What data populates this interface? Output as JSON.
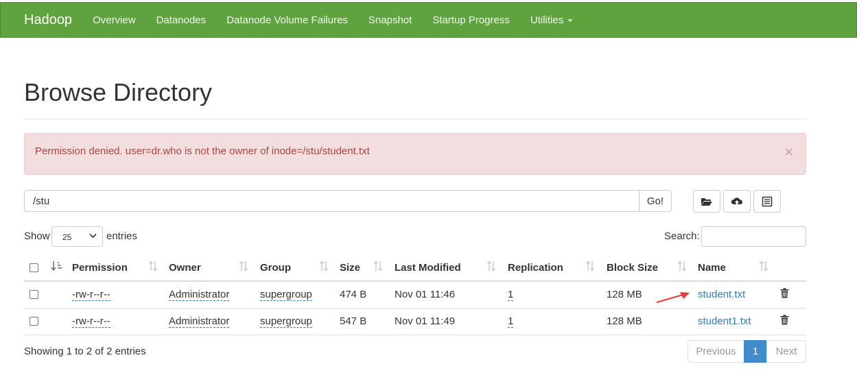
{
  "navbar": {
    "brand": "Hadoop",
    "items": [
      "Overview",
      "Datanodes",
      "Datanode Volume Failures",
      "Snapshot",
      "Startup Progress",
      "Utilities"
    ]
  },
  "page": {
    "title": "Browse Directory"
  },
  "alert": {
    "message": "Permission denied. user=dr.who is not the owner of inode=/stu/student.txt",
    "close": "×"
  },
  "path_bar": {
    "value": "/stu",
    "go_label": "Go!"
  },
  "toolbar_icons": [
    "folder-open-icon",
    "cloud-upload-icon",
    "list-alt-icon"
  ],
  "table_controls": {
    "show_label": "Show",
    "page_size": "25",
    "entries_label": "entries",
    "search_label": "Search:",
    "search_value": ""
  },
  "table": {
    "columns": [
      "Permission",
      "Owner",
      "Group",
      "Size",
      "Last Modified",
      "Replication",
      "Block Size",
      "Name"
    ],
    "rows": [
      {
        "permission": "-rw-r--r--",
        "owner": "Administrator",
        "group": "supergroup",
        "size": "474 B",
        "last_modified": "Nov 01 11:46",
        "replication": "1",
        "block_size": "128 MB",
        "name": "student.txt"
      },
      {
        "permission": "-rw-r--r--",
        "owner": "Administrator",
        "group": "supergroup",
        "size": "547 B",
        "last_modified": "Nov 01 11:49",
        "replication": "1",
        "block_size": "128 MB",
        "name": "student1.txt"
      }
    ]
  },
  "footer": {
    "info": "Showing 1 to 2 of 2 entries",
    "previous": "Previous",
    "current_page": "1",
    "next": "Next"
  },
  "colors": {
    "navbar": "#5fa33e",
    "alert_bg": "#f2dede",
    "alert_text": "#a94442",
    "link": "#337ab7",
    "active_page": "#428bca",
    "annotation_arrow": "#e83a3a"
  }
}
